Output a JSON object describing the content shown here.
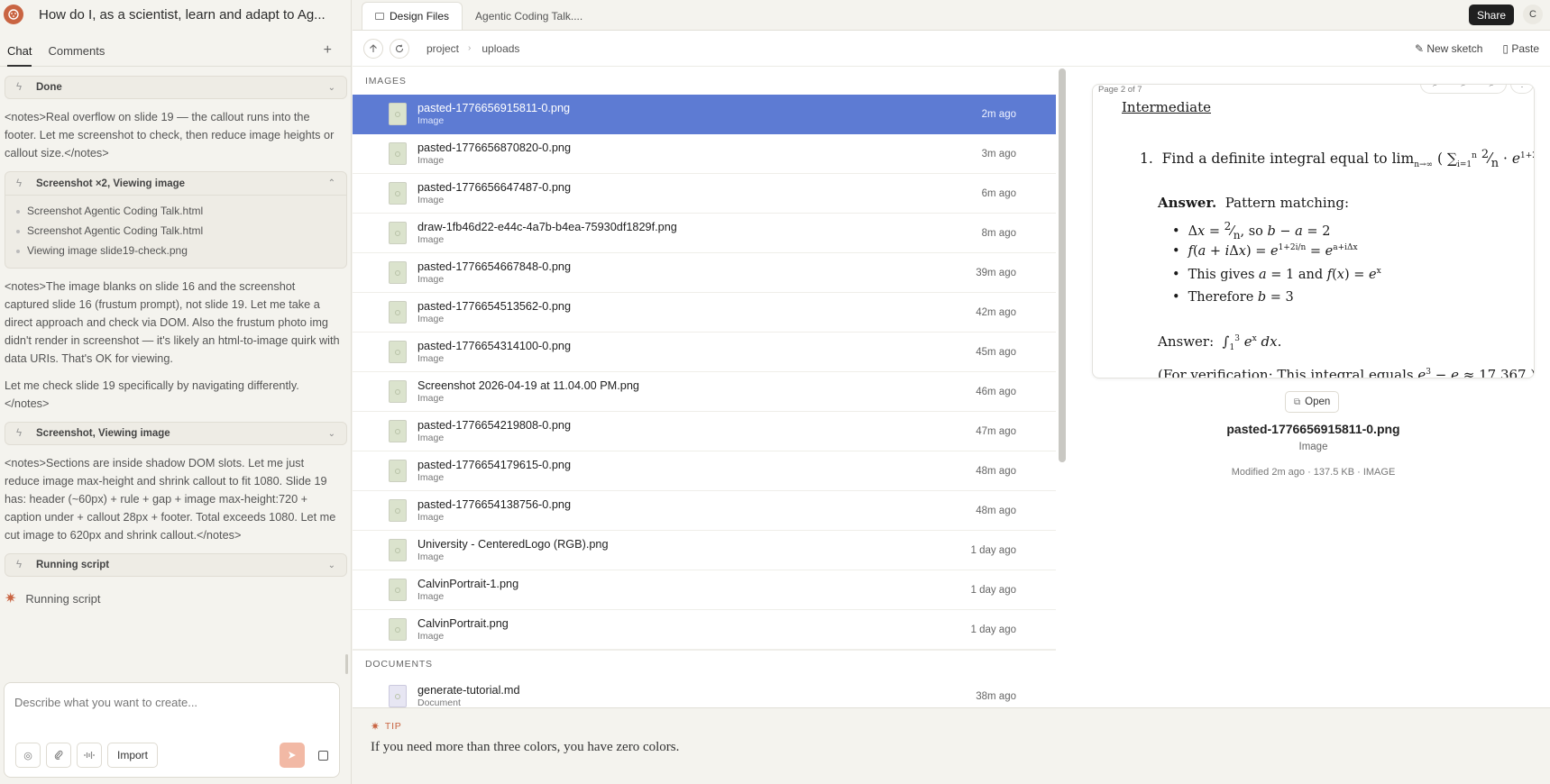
{
  "app": {
    "title": "How do I, as a scientist, learn and adapt to Ag..."
  },
  "chat_tabs": [
    {
      "label": "Chat"
    },
    {
      "label": "Comments"
    }
  ],
  "chat": {
    "new_label": "+",
    "chip_done": "Done",
    "note1": "<notes>Real overflow on slide 19 — the callout runs into the footer. Let me screenshot to check, then reduce image heights or callout size.</notes>",
    "group_title": "Screenshot ×2, Viewing image",
    "group_items": [
      "Screenshot Agentic Coding Talk.html",
      "Screenshot Agentic Coding Talk.html",
      "Viewing image slide19-check.png"
    ],
    "note2": "<notes>The image blanks on slide 16 and the screenshot captured slide 16 (frustum prompt), not slide 19. Let me take a direct approach and check via DOM. Also the frustum photo img didn't render in screenshot — it's likely an html-to-image quirk with data URIs. That's OK for viewing.",
    "note3": "Let me check slide 19 specifically by navigating differently.</notes>",
    "chip_screenshot": "Screenshot, Viewing image",
    "note4": "<notes>Sections are inside shadow DOM slots. Let me just reduce image max-height and shrink callout to fit 1080. Slide 19 has: header (~60px) + rule + gap + image max-height:720 + caption under + callout 28px + footer. Total exceeds 1080. Let me cut image to 620px and shrink callout.</notes>",
    "chip_running": "Running script",
    "running_status": "Running script"
  },
  "composer": {
    "placeholder": "Describe what you want to create...",
    "import_label": "Import"
  },
  "file_tabs": [
    {
      "label": "Design Files"
    },
    {
      "label": "Agentic Coding Talk...."
    }
  ],
  "header": {
    "share_label": "Share",
    "avatar_initial": "C"
  },
  "path": {
    "crumbs": [
      "project",
      "uploads"
    ],
    "new_sketch": "New sketch",
    "paste": "Paste"
  },
  "sections": {
    "images": "IMAGES",
    "documents": "DOCUMENTS"
  },
  "files": [
    {
      "name": "pasted-1776656915811-0.png",
      "type": "Image",
      "time": "2m ago"
    },
    {
      "name": "pasted-1776656870820-0.png",
      "type": "Image",
      "time": "3m ago"
    },
    {
      "name": "pasted-1776656647487-0.png",
      "type": "Image",
      "time": "6m ago"
    },
    {
      "name": "draw-1fb46d22-e44c-4a7b-b4ea-75930df1829f.png",
      "type": "Image",
      "time": "8m ago"
    },
    {
      "name": "pasted-1776654667848-0.png",
      "type": "Image",
      "time": "39m ago"
    },
    {
      "name": "pasted-1776654513562-0.png",
      "type": "Image",
      "time": "42m ago"
    },
    {
      "name": "pasted-1776654314100-0.png",
      "type": "Image",
      "time": "45m ago"
    },
    {
      "name": "Screenshot 2026-04-19 at 11.04.00 PM.png",
      "type": "Image",
      "time": "46m ago"
    },
    {
      "name": "pasted-1776654219808-0.png",
      "type": "Image",
      "time": "47m ago"
    },
    {
      "name": "pasted-1776654179615-0.png",
      "type": "Image",
      "time": "48m ago"
    },
    {
      "name": "pasted-1776654138756-0.png",
      "type": "Image",
      "time": "48m ago"
    },
    {
      "name": "University - CenteredLogo (RGB).png",
      "type": "Image",
      "time": "1 day ago"
    },
    {
      "name": "CalvinPortrait-1.png",
      "type": "Image",
      "time": "1 day ago"
    },
    {
      "name": "CalvinPortrait.png",
      "type": "Image",
      "time": "1 day ago"
    }
  ],
  "documents": [
    {
      "name": "generate-tutorial.md",
      "type": "Document",
      "time": "38m ago"
    }
  ],
  "preview": {
    "page_indicator": "Page 2 of 7",
    "heading": "Intermediate",
    "q_text": "Find a definite integral equal to",
    "answer_label": "Answer.",
    "answer_text": "Pattern matching:",
    "b1_so": ", so",
    "b3_text": "This gives",
    "b3_and": "and",
    "b4_text": "Therefore",
    "final_label": "Answer:",
    "verification": "(For verification: This integral equals",
    "open_label": "Open",
    "name": "pasted-1776656915811-0.png",
    "type": "Image",
    "meta": "Modified 2m ago · 137.5 KB · IMAGE"
  },
  "tip": {
    "label": "TIP",
    "text": "If you need more than three colors, you have zero colors."
  }
}
